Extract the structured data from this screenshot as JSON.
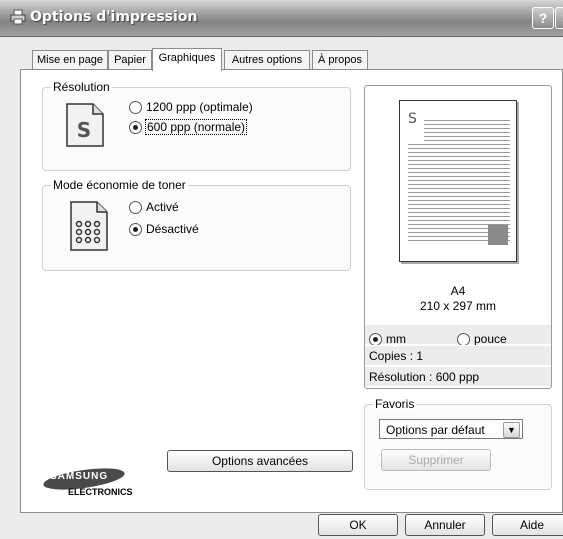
{
  "window": {
    "title": "Options d'impression",
    "help_label": "?",
    "close_label": "×"
  },
  "tabs": [
    {
      "label": "Mise en page"
    },
    {
      "label": "Papier"
    },
    {
      "label": "Graphiques"
    },
    {
      "label": "Autres options"
    },
    {
      "label": "À propos"
    }
  ],
  "resolution": {
    "group_label": "Résolution",
    "options": [
      {
        "label": "1200 ppp (optimale)"
      },
      {
        "label": "600 ppp (normale)"
      }
    ],
    "icon_glyph": "S"
  },
  "toner": {
    "group_label": "Mode économie de toner",
    "options": [
      {
        "label": "Activé"
      },
      {
        "label": "Désactivé"
      }
    ]
  },
  "advanced_button": "Options avancées",
  "logo": {
    "brand": "SAMSUNG",
    "sub": "ELECTRONICS"
  },
  "preview": {
    "page_glyph": "S",
    "paper": "A4",
    "size": "210 x 297 mm",
    "units": [
      {
        "label": "mm"
      },
      {
        "label": "pouce"
      }
    ],
    "copies": "Copies : 1",
    "resolution": "Résolution : 600 ppp"
  },
  "favorites": {
    "group_label": "Favoris",
    "selected": "Options par défaut",
    "delete_button": "Supprimer"
  },
  "footer": {
    "ok": "OK",
    "cancel": "Annuler",
    "help": "Aide"
  }
}
